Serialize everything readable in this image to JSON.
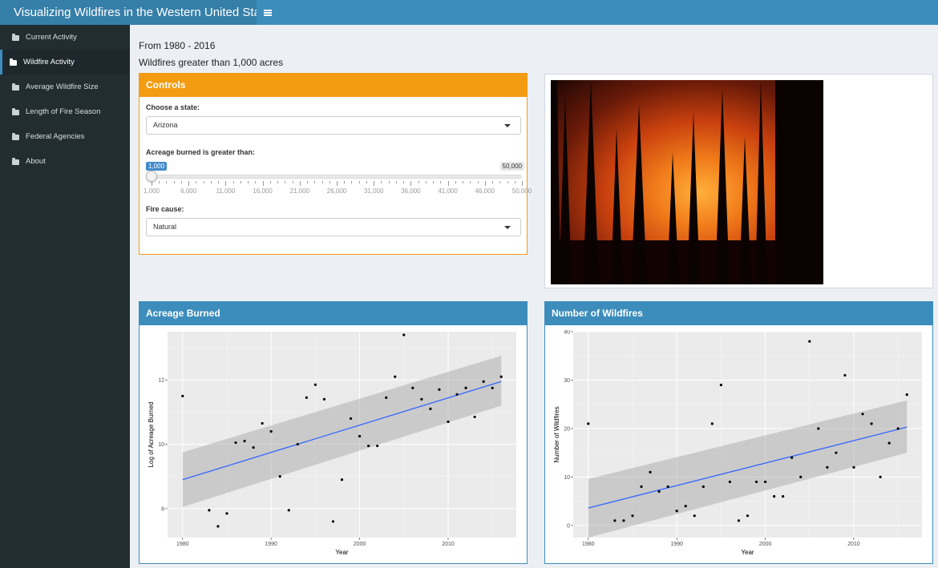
{
  "app_title": "Visualizing Wildfires in the Western United States",
  "sidebar": {
    "items": [
      {
        "label": "Current Activity"
      },
      {
        "label": "Wildfire Activity"
      },
      {
        "label": "Average Wildfire Size"
      },
      {
        "label": "Length of Fire Season"
      },
      {
        "label": "Federal Agencies"
      },
      {
        "label": "About"
      }
    ]
  },
  "main": {
    "subtitle1": "From 1980 - 2016",
    "subtitle2": "Wildfires greater than 1,000 acres"
  },
  "controls": {
    "title": "Controls",
    "state_label": "Choose a state:",
    "state_value": "Arizona",
    "acreage_label": "Acreage burned is greater than:",
    "slider_min": "1,000",
    "slider_max": "50,000",
    "slider_ticks": [
      "1,000",
      "6,000",
      "11,000",
      "16,000",
      "21,000",
      "26,000",
      "31,000",
      "36,000",
      "41,000",
      "46,000",
      "50,000"
    ],
    "cause_label": "Fire cause:",
    "cause_value": "Natural"
  },
  "chart_data": [
    {
      "type": "scatter",
      "title": "Acreage Burned",
      "xlabel": "Year",
      "ylabel": "Log of Acreage Burned",
      "xlim": [
        1980,
        2016
      ],
      "ylim": [
        7.1,
        13.5
      ],
      "xticks": [
        "1980",
        "1990",
        "2000",
        "2010"
      ],
      "yticks": [
        "8",
        "10",
        "12"
      ],
      "xticks_values": [
        1980,
        1990,
        2000,
        2010
      ],
      "yticks_values": [
        8,
        10,
        12
      ],
      "x": [
        1980,
        1983,
        1984,
        1985,
        1986,
        1987,
        1988,
        1989,
        1990,
        1991,
        1992,
        1993,
        1994,
        1995,
        1996,
        1997,
        1998,
        1999,
        2000,
        2001,
        2002,
        2003,
        2004,
        2005,
        2006,
        2007,
        2008,
        2009,
        2010,
        2011,
        2012,
        2013,
        2014,
        2015,
        2016
      ],
      "y": [
        11.5,
        7.95,
        7.45,
        7.85,
        10.05,
        10.1,
        9.9,
        10.65,
        10.4,
        9.0,
        7.95,
        10.0,
        11.45,
        11.85,
        11.4,
        7.6,
        8.9,
        10.8,
        10.25,
        9.95,
        9.95,
        11.45,
        12.1,
        13.4,
        11.75,
        11.4,
        11.1,
        11.7,
        10.7,
        11.55,
        11.75,
        10.85,
        11.95,
        11.75,
        12.1
      ],
      "trend": {
        "x": [
          1980,
          2016
        ],
        "y": [
          8.9,
          11.95
        ]
      },
      "band": {
        "x": [
          1980,
          2016
        ],
        "lower": [
          8.05,
          11.2
        ],
        "upper": [
          9.75,
          12.75
        ]
      },
      "line_color": "#3366ff"
    },
    {
      "type": "scatter",
      "title": "Number of Wildfires",
      "xlabel": "Year",
      "ylabel": "Number of Wildfires",
      "xlim": [
        1980,
        2016
      ],
      "ylim": [
        -2.5,
        40
      ],
      "xticks": [
        "1980",
        "1990",
        "2000",
        "2010"
      ],
      "yticks": [
        "0",
        "10",
        "20",
        "30",
        "40"
      ],
      "xticks_values": [
        1980,
        1990,
        2000,
        2010
      ],
      "yticks_values": [
        0,
        10,
        20,
        30,
        40
      ],
      "x": [
        1980,
        1983,
        1984,
        1985,
        1986,
        1987,
        1988,
        1989,
        1990,
        1991,
        1992,
        1993,
        1994,
        1995,
        1996,
        1997,
        1998,
        1999,
        2000,
        2001,
        2002,
        2003,
        2004,
        2005,
        2006,
        2007,
        2008,
        2009,
        2010,
        2011,
        2012,
        2013,
        2014,
        2015,
        2016
      ],
      "y": [
        21,
        1,
        1,
        2,
        8,
        11,
        7,
        8,
        3,
        4,
        2,
        8,
        21,
        29,
        9,
        1,
        2,
        9,
        9,
        6,
        6,
        14,
        10,
        38,
        20,
        12,
        15,
        31,
        12,
        23,
        21,
        10,
        17,
        20,
        27
      ],
      "trend": {
        "x": [
          1980,
          2016
        ],
        "y": [
          3.6,
          20.3
        ]
      },
      "band": {
        "x": [
          1980,
          2016
        ],
        "lower": [
          -2.5,
          15.0
        ],
        "upper": [
          9.6,
          25.8
        ]
      },
      "line_color": "#3366ff"
    }
  ]
}
